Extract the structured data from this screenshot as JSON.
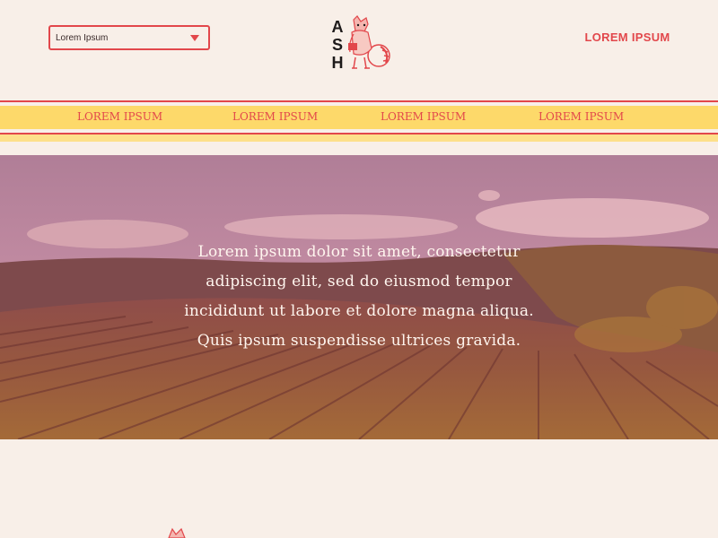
{
  "header": {
    "select": {
      "value": "Lorem Ipsum",
      "icon": "chevron-down-icon"
    },
    "logo": {
      "letters": [
        "A",
        "S",
        "H"
      ]
    },
    "link_label": "LOREM IPSUM"
  },
  "nav": {
    "items": [
      {
        "label": "LOREM IPSUM"
      },
      {
        "label": "LOREM IPSUM"
      },
      {
        "label": "LOREM IPSUM"
      },
      {
        "label": "LOREM IPSUM"
      }
    ]
  },
  "hero": {
    "lines": [
      "Lorem ipsum dolor sit amet, consectetur",
      "adipiscing elit, sed do eiusmod tempor",
      "incididunt ut labore et dolore magna aliqua.",
      "Quis ipsum suspendisse ultrices gravida."
    ]
  },
  "colors": {
    "background": "#f8efe8",
    "accent_red": "#e2474b",
    "nav_yellow": "#fdd96a",
    "hero_text": "#fff5ee"
  }
}
